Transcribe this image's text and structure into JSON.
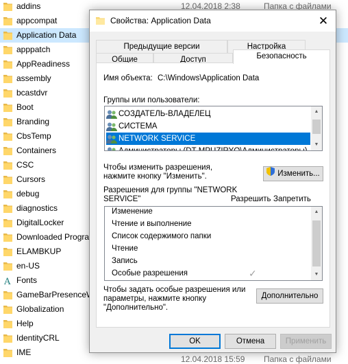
{
  "explorer": {
    "top_date": "12.04.2018 2:38",
    "top_type": "Папка с файлами",
    "bottom_date": "12.04.2018 15:59",
    "bottom_type": "Папка с файлами",
    "items": [
      {
        "name": "addins",
        "icon": "folder-icon"
      },
      {
        "name": "appcompat",
        "icon": "folder-icon"
      },
      {
        "name": "Application Data",
        "icon": "folder-shortcut-icon"
      },
      {
        "name": "apppatch",
        "icon": "folder-icon"
      },
      {
        "name": "AppReadiness",
        "icon": "folder-icon"
      },
      {
        "name": "assembly",
        "icon": "folder-icon"
      },
      {
        "name": "bcastdvr",
        "icon": "folder-icon"
      },
      {
        "name": "Boot",
        "icon": "folder-icon"
      },
      {
        "name": "Branding",
        "icon": "folder-icon"
      },
      {
        "name": "CbsTemp",
        "icon": "folder-icon"
      },
      {
        "name": "Containers",
        "icon": "folder-icon"
      },
      {
        "name": "CSC",
        "icon": "folder-icon"
      },
      {
        "name": "Cursors",
        "icon": "folder-icon"
      },
      {
        "name": "debug",
        "icon": "folder-icon"
      },
      {
        "name": "diagnostics",
        "icon": "folder-icon"
      },
      {
        "name": "DigitalLocker",
        "icon": "folder-icon"
      },
      {
        "name": "Downloaded Progra",
        "icon": "folder-icon"
      },
      {
        "name": "ELAMBKUP",
        "icon": "folder-icon"
      },
      {
        "name": "en-US",
        "icon": "folder-icon"
      },
      {
        "name": "Fonts",
        "icon": "fonts-folder-icon"
      },
      {
        "name": "GameBarPresenceW",
        "icon": "folder-icon"
      },
      {
        "name": "Globalization",
        "icon": "folder-icon"
      },
      {
        "name": "Help",
        "icon": "folder-icon"
      },
      {
        "name": "IdentityCRL",
        "icon": "folder-icon"
      },
      {
        "name": "IME",
        "icon": "folder-icon"
      }
    ],
    "selected_index": 2
  },
  "dialog": {
    "title": "Свойства: Application Data",
    "close_glyph": "✕",
    "tabs_row1": [
      "Предыдущие версии",
      "Настройка"
    ],
    "tabs_row2": [
      "Общие",
      "Доступ",
      "Безопасность"
    ],
    "active_tab": "Безопасность",
    "object_label": "Имя объекта:",
    "object_value": "C:\\Windows\\Application Data",
    "groups_label": "Группы или пользователи:",
    "groups": [
      "СОЗДАТЕЛЬ-ВЛАДЕЛЕЦ",
      "СИСТЕМА",
      "NETWORK SERVICE",
      "Администраторы (DT-MPUZIRYQ\\Администраторы)"
    ],
    "groups_selected_index": 2,
    "change_hint": "Чтобы изменить разрешения,\nнажмите кнопку \"Изменить\".",
    "change_button": "Изменить...",
    "perms_label": "Разрешения для группы \"NETWORK\nSERVICE\"",
    "allow_header": "Разрешить",
    "deny_header": "Запретить",
    "permissions": [
      {
        "name": "Изменение",
        "allow": false
      },
      {
        "name": "Чтение и выполнение",
        "allow": false
      },
      {
        "name": "Список содержимого папки",
        "allow": false
      },
      {
        "name": "Чтение",
        "allow": false
      },
      {
        "name": "Запись",
        "allow": false
      },
      {
        "name": "Особые разрешения",
        "allow": true
      }
    ],
    "advanced_hint": "Чтобы задать особые разрешения или\nпараметры, нажмите кнопку\n\"Дополнительно\".",
    "advanced_button": "Дополнительно",
    "ok_button": "OK",
    "cancel_button": "Отмена",
    "apply_button": "Применить",
    "check_glyph": "✓"
  }
}
